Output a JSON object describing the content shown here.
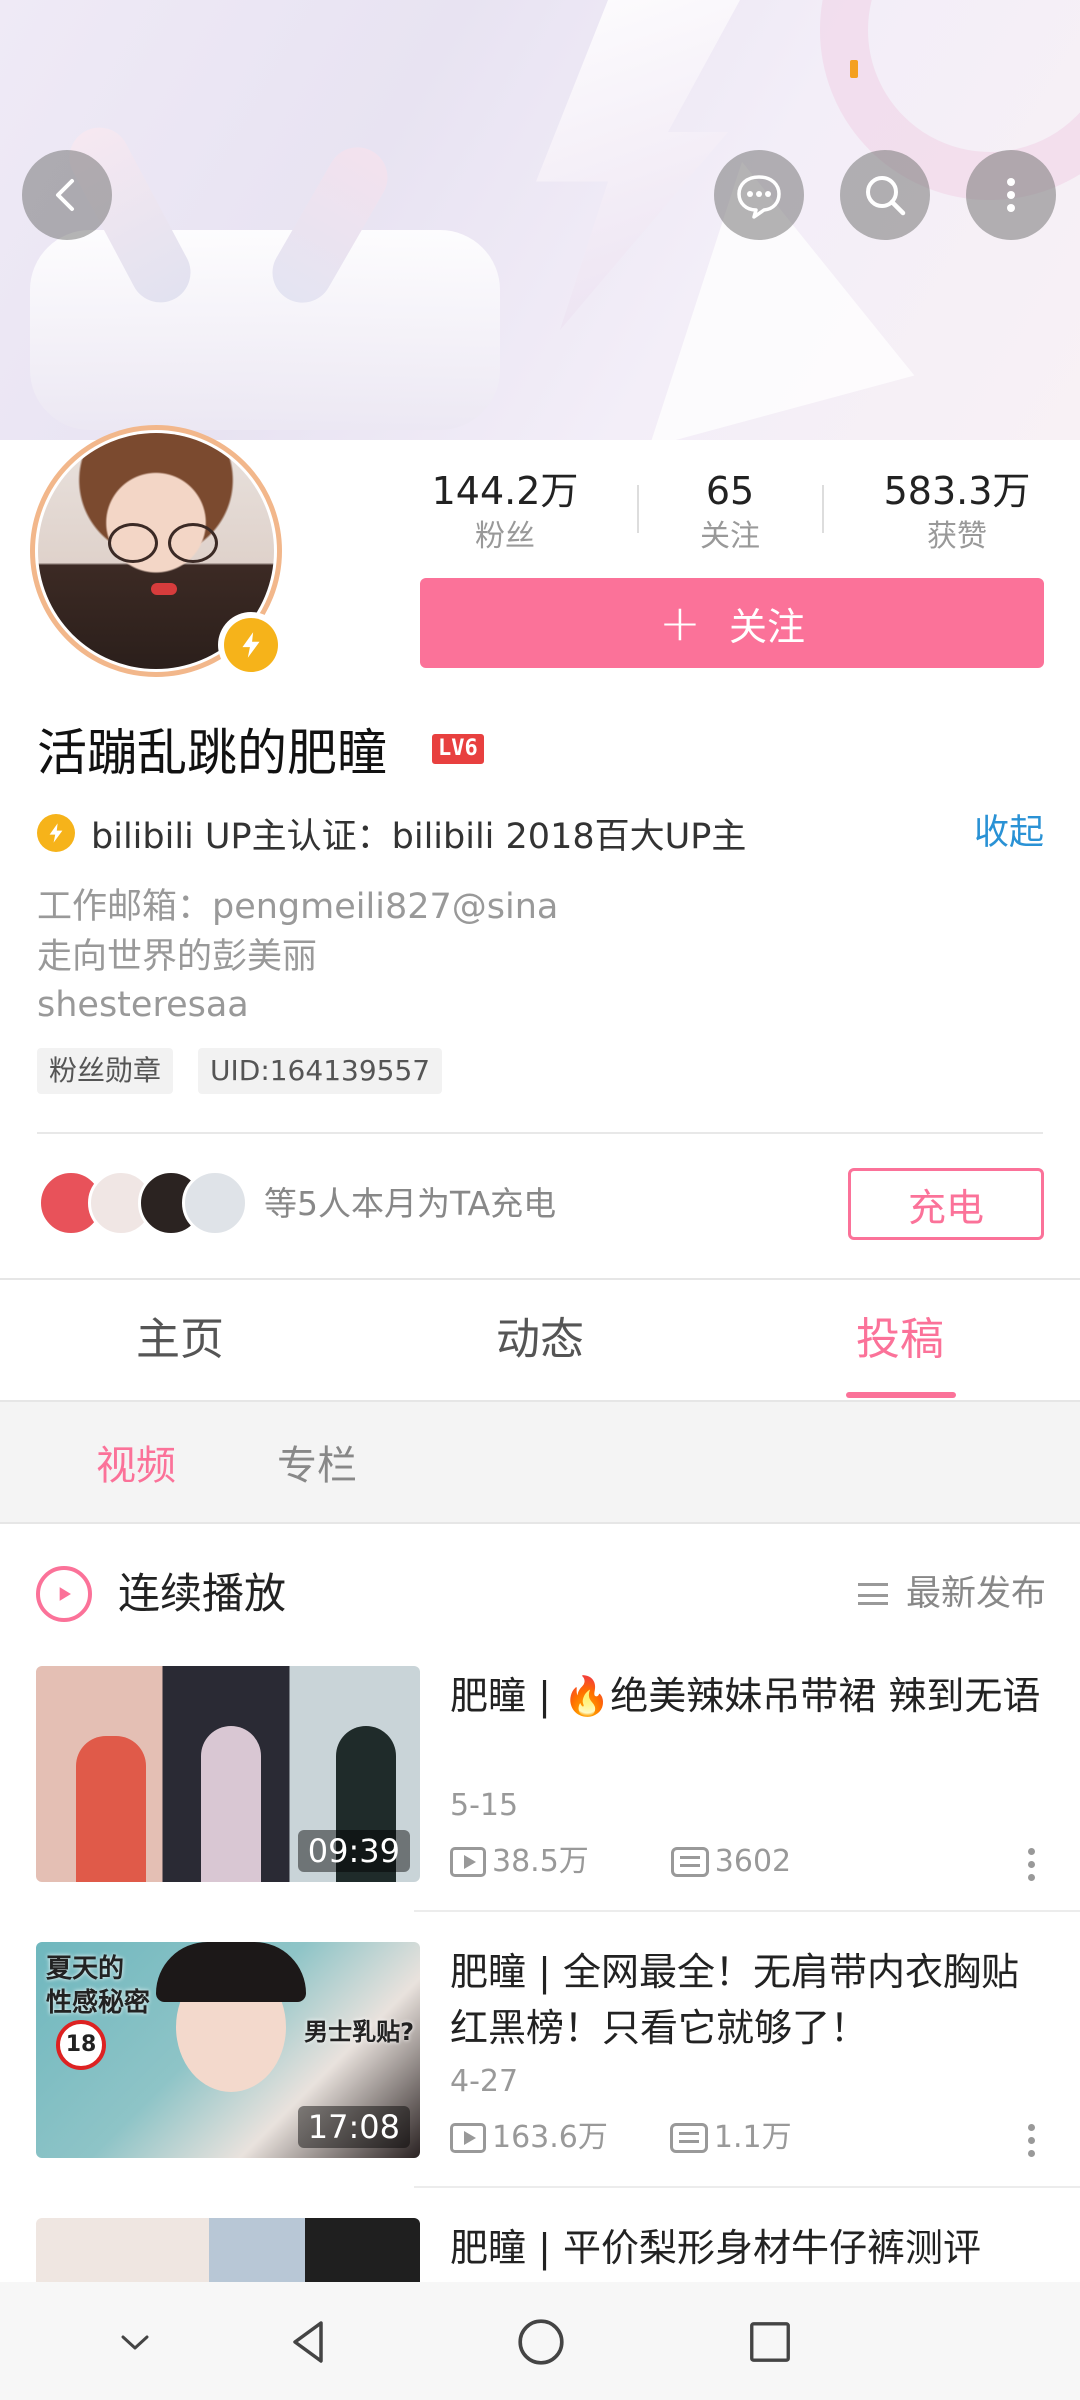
{
  "header": {
    "back_icon": "chevron-left-icon",
    "message_icon": "message-bubble-icon",
    "search_icon": "search-icon",
    "more_icon": "more-vertical-icon"
  },
  "profile": {
    "stats": [
      {
        "value": "144.2万",
        "label": "粉丝"
      },
      {
        "value": "65",
        "label": "关注"
      },
      {
        "value": "583.3万",
        "label": "获赞"
      }
    ],
    "follow_label": "关注",
    "name": "活蹦乱跳的肥瞳",
    "level_badge": "LV6",
    "certification": "bilibili UP主认证：bilibili 2018百大UP主",
    "collapse_label": "收起",
    "bio": [
      "工作邮箱：pengmeili827@sina",
      "走向世界的彭美丽",
      "shesteresaa"
    ],
    "tags": [
      "粉丝勋章",
      "UID:164139557"
    ],
    "charge_text": "等5人本月为TA充电",
    "charge_button": "充电"
  },
  "tabs": [
    "主页",
    "动态",
    "投稿"
  ],
  "active_tab": "投稿",
  "subtabs": [
    "视频",
    "专栏"
  ],
  "active_subtab": "视频",
  "list_header": {
    "continuous_play": "连续播放",
    "sort_label": "最新发布"
  },
  "videos": [
    {
      "title": "肥瞳 | 🔥绝美辣妹吊带裙 辣到无语",
      "date": "5-15",
      "views": "38.5万",
      "danmaku": "3602",
      "duration": "09:39"
    },
    {
      "title": "肥瞳 | 全网最全！无肩带内衣胸贴 红黑榜！只看它就够了！",
      "date": "4-27",
      "views": "163.6万",
      "danmaku": "1.1万",
      "duration": "17:08",
      "thumb_text_1": "夏天的",
      "thumb_text_2": "性感秘密",
      "thumb_text_3": "男士乳贴?"
    },
    {
      "title": "肥瞳 | 平价梨形身材牛仔裤测评"
    }
  ],
  "colors": {
    "accent": "#fb7299",
    "link": "#2a92d5",
    "badge": "#f6b31a"
  }
}
